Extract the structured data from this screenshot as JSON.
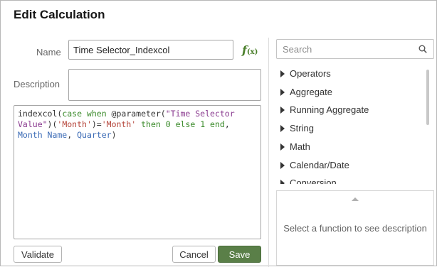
{
  "dialog": {
    "title": "Edit Calculation"
  },
  "form": {
    "name_label": "Name",
    "name_value": "Time Selector_Indexcol",
    "description_label": "Description",
    "description_value": ""
  },
  "expression": {
    "tokens": [
      {
        "text": "indexcol(",
        "kind": "plain"
      },
      {
        "text": "case when",
        "kind": "keyword"
      },
      {
        "text": " @parameter(",
        "kind": "plain"
      },
      {
        "text": "\"Time Selector Value\"",
        "kind": "string"
      },
      {
        "text": ")(",
        "kind": "plain"
      },
      {
        "text": "'Month'",
        "kind": "literal"
      },
      {
        "text": ")=",
        "kind": "plain"
      },
      {
        "text": "'Month'",
        "kind": "literal"
      },
      {
        "text": " then 0 else 1 end",
        "kind": "keyword"
      },
      {
        "text": ", ",
        "kind": "plain"
      },
      {
        "text": "Month Name",
        "kind": "column"
      },
      {
        "text": ", ",
        "kind": "plain"
      },
      {
        "text": "Quarter",
        "kind": "column"
      },
      {
        "text": ")",
        "kind": "plain"
      }
    ]
  },
  "buttons": {
    "validate": "Validate",
    "cancel": "Cancel",
    "save": "Save"
  },
  "functions": {
    "search_placeholder": "Search",
    "categories": [
      "Operators",
      "Aggregate",
      "Running Aggregate",
      "String",
      "Math",
      "Calendar/Date",
      "Conversion"
    ],
    "description_placeholder": "Select a function to see description"
  },
  "icons": {
    "function_icon": "fx-icon",
    "search_icon": "search-icon"
  },
  "colors": {
    "save_button": "#5a7f48",
    "keyword": "#3a8a2a",
    "string": "#8a3a8f",
    "literal": "#b5453a",
    "column": "#3a6ab5"
  }
}
